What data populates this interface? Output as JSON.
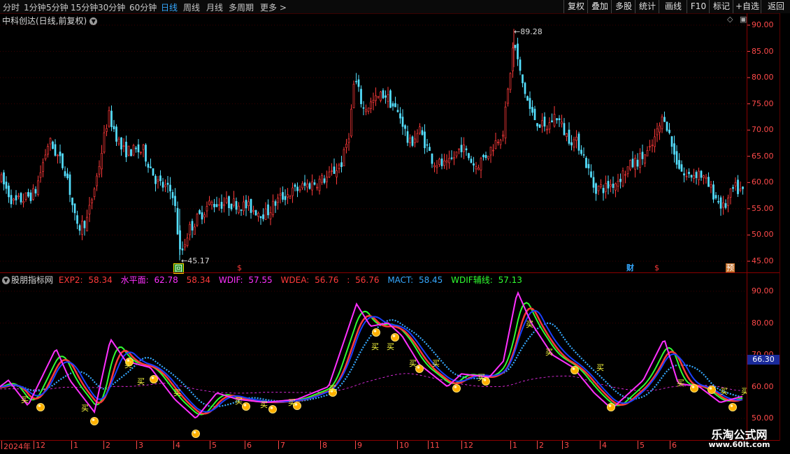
{
  "toolbar": {
    "periods": [
      "分时",
      "1分钟",
      "5分钟",
      "15分钟",
      "30分钟",
      "60分钟",
      "日线",
      "周线",
      "月线",
      "多周期",
      "更多 >"
    ],
    "active_period": "日线",
    "buttons": [
      "复权",
      "叠加",
      "多股",
      "统计",
      "画线",
      "F10",
      "标记",
      "+自选",
      "返回"
    ]
  },
  "main_chart": {
    "title": "中科创达(日线,前复权)",
    "high_label": "89.28",
    "low_label": "45.17",
    "y_ticks": [
      "90.00",
      "85.00",
      "80.00",
      "75.00",
      "70.00",
      "65.00",
      "60.00",
      "55.00",
      "50.00",
      "45.00"
    ],
    "markers": {
      "hui": "回",
      "dollar": "$",
      "cai": "财",
      "yu": "预"
    }
  },
  "indicator": {
    "name": "股朋指标网",
    "items": [
      {
        "label": "EXP2:",
        "value": "58.34",
        "color": "#ff3a3a"
      },
      {
        "label": "水平面:",
        "value": "62.78",
        "color": "#ff30ff"
      },
      {
        "label": "",
        "value": "58.34",
        "color": "#ff3a3a"
      },
      {
        "label": "WDIF:",
        "value": "57.55",
        "color": "#ff30ff"
      },
      {
        "label": "WDEA:",
        "value": "56.76",
        "color": "#ff3a3a"
      },
      {
        "label": ":",
        "value": "56.76",
        "color": "#ff3a3a"
      },
      {
        "label": "MACT:",
        "value": "58.45",
        "color": "#35a8ff"
      },
      {
        "label": "WDIF辅线:",
        "value": "57.13",
        "color": "#30ff30"
      }
    ],
    "y_ticks": [
      "90.00",
      "80.00",
      "70.00",
      "60.00",
      "50.00"
    ],
    "current_value": "66.30",
    "buy_label": "买"
  },
  "x_axis": {
    "labels": [
      "2024年",
      "12",
      "1",
      "2",
      "3",
      "4",
      "5",
      "6",
      "7",
      "8",
      "9",
      "10",
      "11",
      "12",
      "1",
      "2",
      "3",
      "4",
      "5",
      "6"
    ]
  },
  "watermark": {
    "line1": "乐淘公式网",
    "line2": "www.60lt.com"
  },
  "colors": {
    "up": "#ff3a3a",
    "down": "#54e0ff",
    "axis": "#ff4a4a",
    "grid": "#5a0000"
  },
  "chart_data": {
    "type": "candlestick",
    "price_range": [
      45.17,
      89.28
    ],
    "highest": 89.28,
    "lowest": 45.17,
    "y_axis_range": [
      43,
      91
    ],
    "indicator_y_axis_range": [
      48,
      93
    ],
    "indicator_latest": {
      "EXP2": 58.34,
      "水平面": 62.78,
      "WDIF": 57.55,
      "WDEA": 56.76,
      "MACT": 58.45,
      "WDIF辅线": 57.13
    }
  }
}
